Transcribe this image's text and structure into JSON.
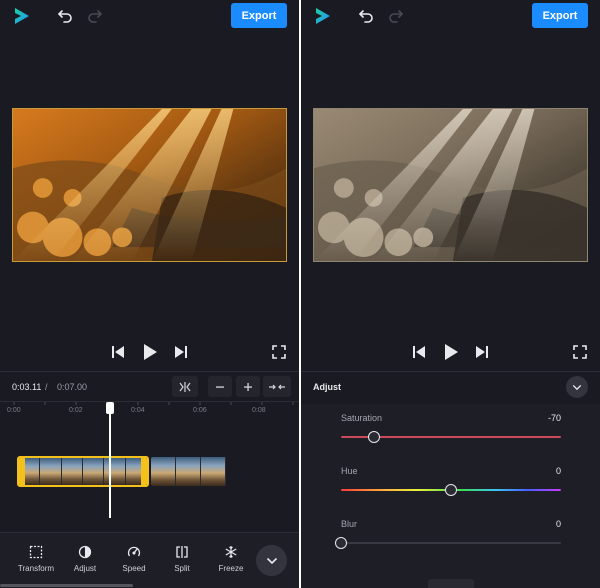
{
  "header": {
    "export_label": "Export"
  },
  "left": {
    "time": {
      "current": "0:03.11",
      "separator": "/",
      "total": "0:07.00"
    },
    "ruler_ticks": [
      "0:00",
      "0:02",
      "0:04",
      "0:06",
      "0:08"
    ],
    "toolbar": [
      {
        "label": "Transform",
        "icon": "transform-icon"
      },
      {
        "label": "Adjust",
        "icon": "adjust-icon"
      },
      {
        "label": "Speed",
        "icon": "speed-icon"
      },
      {
        "label": "Split",
        "icon": "split-icon"
      },
      {
        "label": "Freeze",
        "icon": "snowflake-icon"
      }
    ]
  },
  "right": {
    "adjust": {
      "title": "Adjust",
      "sliders": [
        {
          "label": "Saturation",
          "value": "-70",
          "min": -100,
          "max": 100
        },
        {
          "label": "Hue",
          "value": "0",
          "min": -180,
          "max": 180
        },
        {
          "label": "Blur",
          "value": "0",
          "min": 0,
          "max": 100
        }
      ]
    }
  },
  "colors": {
    "accent": "#1a8cff",
    "selection": "#f3c01c",
    "background": "#1a1a22",
    "logo": "#1fc0a8"
  }
}
